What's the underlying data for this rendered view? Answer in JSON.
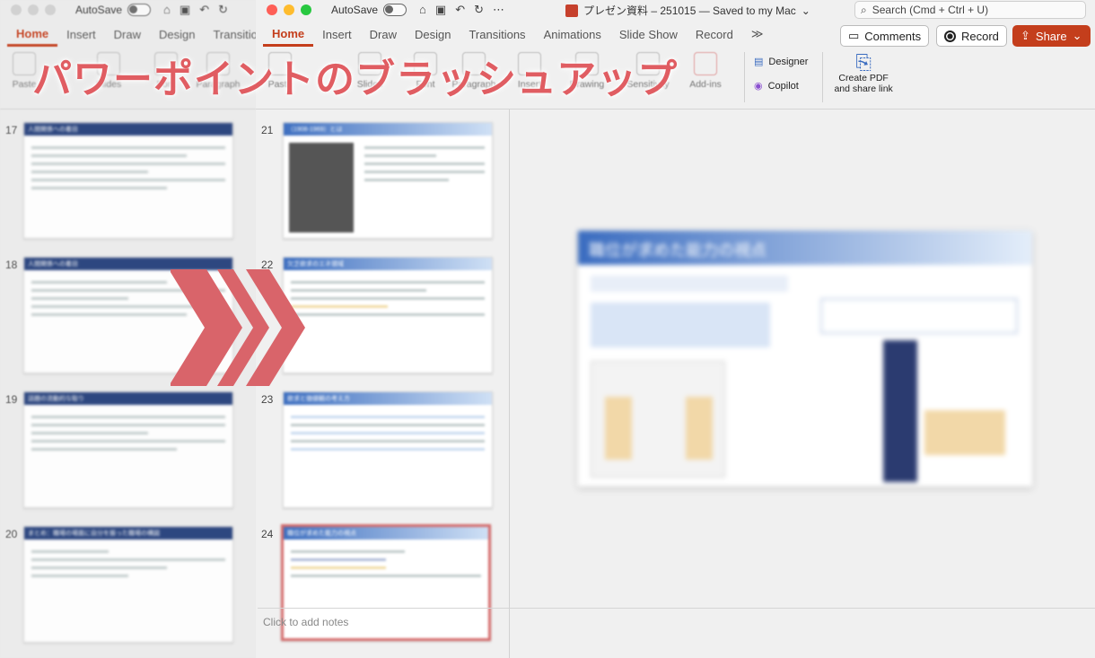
{
  "overlay": {
    "title": "パワーポイントのブラッシュアップ"
  },
  "window_left": {
    "autosave_label": "AutoSave",
    "tabs": [
      "Home",
      "Insert",
      "Draw",
      "Design",
      "Transitio"
    ],
    "ribbon": [
      "Paste",
      "Slides",
      "Font",
      "Paragraph"
    ],
    "thumbnails": [
      {
        "number": "17",
        "header": "人間関係への着目"
      },
      {
        "number": "18",
        "header": "人間関係への着目"
      },
      {
        "number": "19",
        "header": "話題の流動的な取り"
      },
      {
        "number": "20",
        "header": "まとめ：職場の場面に自分を振った職場の構図"
      }
    ]
  },
  "window_right": {
    "autosave_label": "AutoSave",
    "doc_title": "プレゼン資料 – 251015 — Saved to my Mac",
    "search_placeholder": "Search (Cmd + Ctrl + U)",
    "tabs": [
      "Home",
      "Insert",
      "Draw",
      "Design",
      "Transitions",
      "Animations",
      "Slide Show",
      "Record"
    ],
    "more_tabs": "≫",
    "comments_label": "Comments",
    "record_label": "Record",
    "share_label": "Share",
    "ribbon": [
      "Paste",
      "Slides",
      "Font",
      "Paragraph",
      "Insert",
      "Drawing",
      "Sensitivity",
      "Add-ins"
    ],
    "designer_label": "Designer",
    "copilot_label": "Copilot",
    "create_pdf_label_1": "Create PDF",
    "create_pdf_label_2": "and share link",
    "thumbnails": [
      {
        "number": "21",
        "header": "（1908-1969）とは"
      },
      {
        "number": "22",
        "header": "欠乏欲求のエネ領域"
      },
      {
        "number": "23",
        "header": "欲求と価値観の考え方"
      },
      {
        "number": "24",
        "header": "職位が求めた能力の視点"
      }
    ],
    "main_slide_title": "職位が求めた能力の視点",
    "notes_placeholder": "Click to add notes"
  },
  "colors": {
    "accent": "#c43e1c",
    "overlay_text": "#e05d62",
    "chevron": "#d9646a"
  }
}
